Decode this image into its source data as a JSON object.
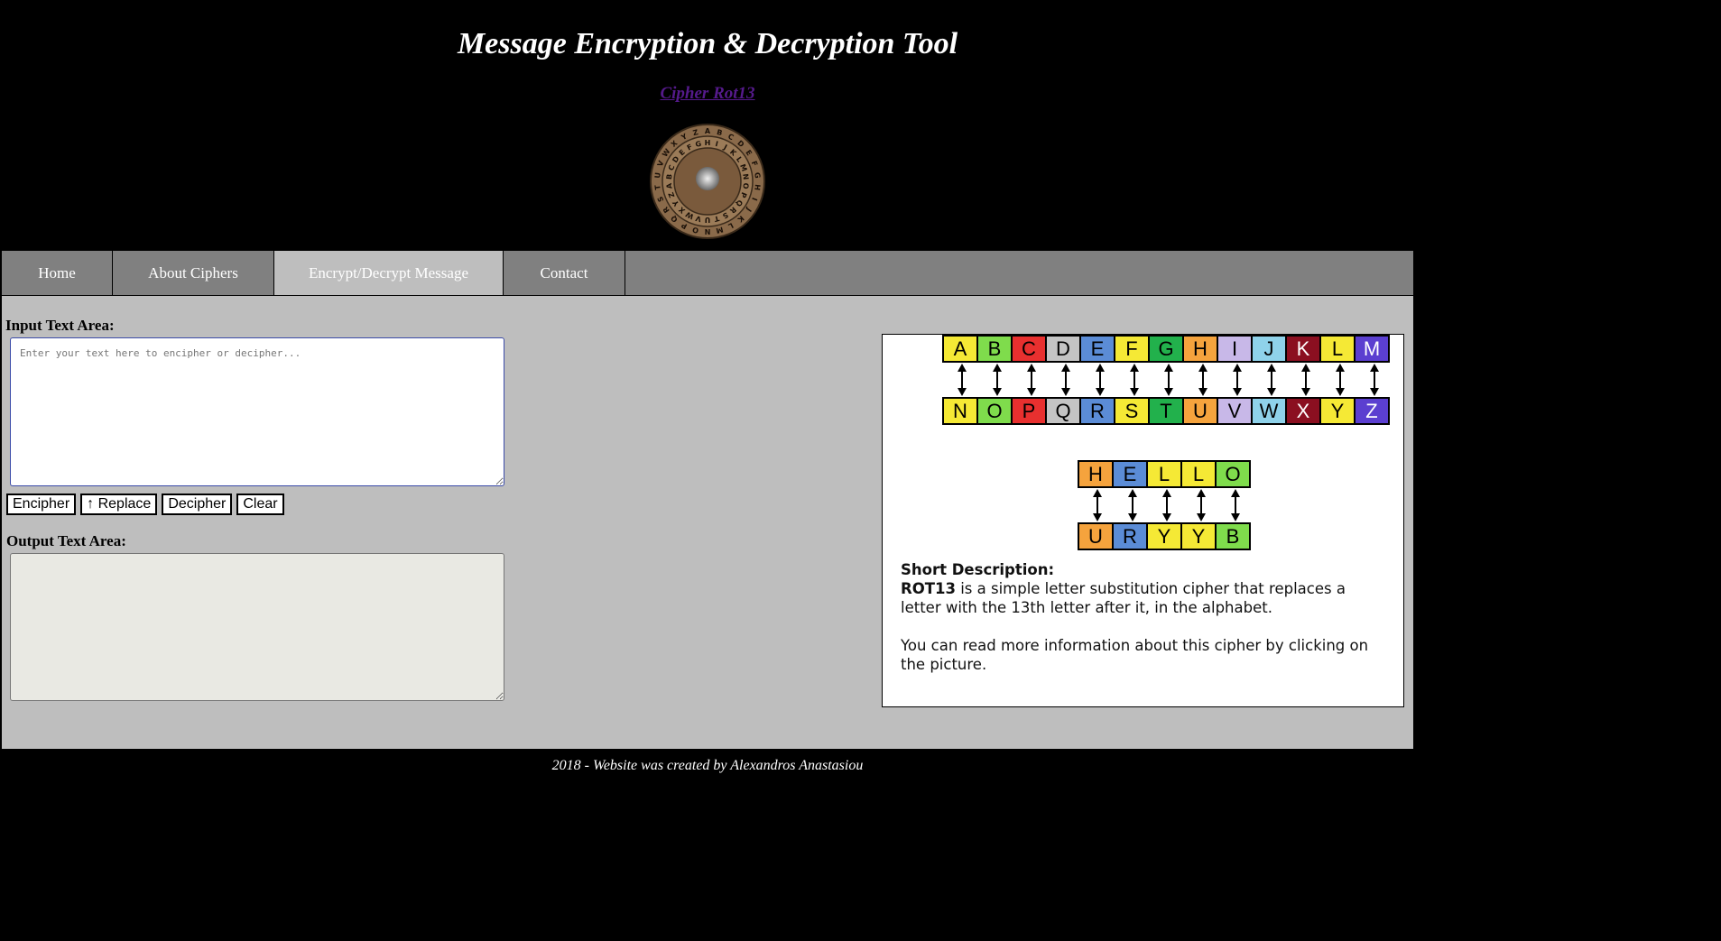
{
  "header": {
    "title": "Message Encryption & Decryption Tool",
    "cipher_link": "Cipher Rot13",
    "wheel_letters": "ABCDEFGHIJKLMNOPQRSTUVWXYZ"
  },
  "nav": {
    "items": [
      {
        "label": "Home",
        "active": false
      },
      {
        "label": "About Ciphers",
        "active": false
      },
      {
        "label": "Encrypt/Decrypt Message",
        "active": true
      },
      {
        "label": "Contact",
        "active": false
      }
    ]
  },
  "input": {
    "label": "Input Text Area:",
    "placeholder": "Enter your text here to encipher or decipher...",
    "value": ""
  },
  "buttons": {
    "encipher": "Encipher",
    "replace": "↑ Replace",
    "decipher": "Decipher",
    "clear": "Clear"
  },
  "output": {
    "label": "Output Text Area:",
    "value": ""
  },
  "infobox": {
    "top_row": [
      "A",
      "B",
      "C",
      "D",
      "E",
      "F",
      "G",
      "H",
      "I",
      "J",
      "K",
      "L",
      "M"
    ],
    "bottom_row": [
      "N",
      "O",
      "P",
      "Q",
      "R",
      "S",
      "T",
      "U",
      "V",
      "W",
      "X",
      "Y",
      "Z"
    ],
    "row_colors": [
      "#f5e935",
      "#7fdc4c",
      "#e8302f",
      "#c4c4c4",
      "#5b8cd6",
      "#f5e935",
      "#22b14c",
      "#f5a33d",
      "#c8b8e8",
      "#8fd2ea",
      "#8b0f20",
      "#f5e935",
      "#5b3fd0"
    ],
    "example_plain": [
      "H",
      "E",
      "L",
      "L",
      "O"
    ],
    "example_cipher": [
      "U",
      "R",
      "Y",
      "Y",
      "B"
    ],
    "example_colors": [
      "#f5a33d",
      "#5b8cd6",
      "#f5e935",
      "#f5e935",
      "#7fdc4c"
    ],
    "desc_heading": "Short Description:",
    "desc_term": "ROT13",
    "desc_text": " is a simple letter substitution cipher that replaces a letter with the 13th letter after it, in the alphabet.",
    "desc_more": "You can read more information about this cipher by clicking on the picture."
  },
  "footer": {
    "text": "2018 - Website was created by Alexandros Anastasiou"
  }
}
